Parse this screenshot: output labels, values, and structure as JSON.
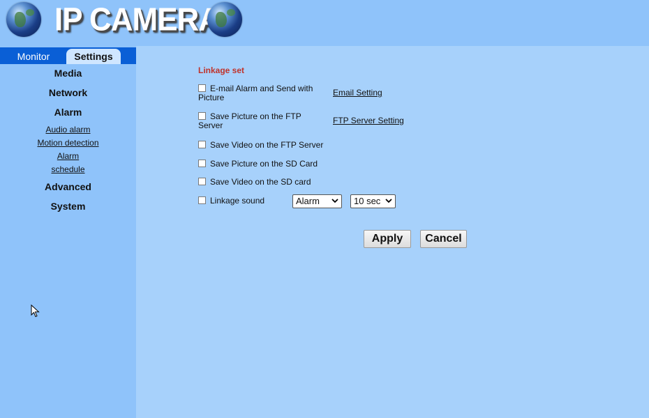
{
  "header": {
    "logo_text": "IP CAMERA"
  },
  "tabs": {
    "monitor": "Monitor",
    "settings": "Settings"
  },
  "sidebar": {
    "media": "Media",
    "network": "Network",
    "alarm": "Alarm",
    "alarm_sub": [
      "Audio alarm",
      "Motion detection",
      "Alarm",
      "schedule"
    ],
    "advanced": "Advanced",
    "system": "System"
  },
  "linkage": {
    "title": "Linkage set",
    "email_line1": "E-mail Alarm and Send with",
    "email_line2": "Picture",
    "email_link": "Email Setting",
    "ftp_pic_line1": "Save Picture on the FTP",
    "ftp_pic_line2": "Server",
    "ftp_link": "FTP Server Setting",
    "ftp_video": "Save Video on the FTP Server",
    "sd_pic": "Save Picture on the SD Card",
    "sd_video": "Save Video on the SD card",
    "sound": "Linkage sound",
    "sound_select": "Alarm",
    "duration_select": "10 sec"
  },
  "buttons": {
    "apply": "Apply",
    "cancel": "Cancel"
  }
}
